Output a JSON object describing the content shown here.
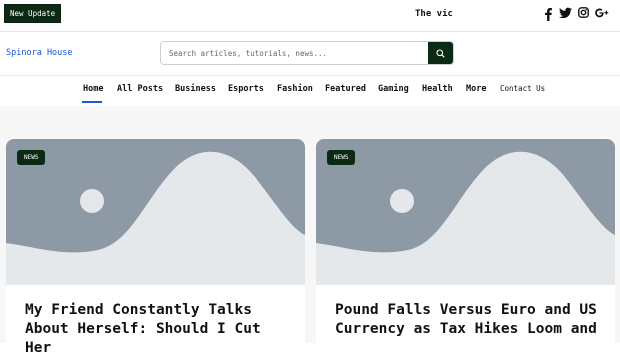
{
  "topbar": {
    "update_label": "New Update",
    "ticker_text": "The vic",
    "social_icons": [
      "facebook-icon",
      "twitter-icon",
      "instagram-icon",
      "google-plus-icon"
    ]
  },
  "header": {
    "site_name": "Spinora House",
    "search_placeholder": "Search articles, tutorials, news...",
    "search_icon": "search-icon"
  },
  "nav": {
    "items": [
      "Home",
      "All Posts",
      "Business",
      "Esports",
      "Fashion",
      "Featured",
      "Gaming",
      "Health",
      "More",
      "Contact Us"
    ],
    "active": "Home"
  },
  "cards": [
    {
      "badge": "NEWS",
      "title": "My Friend Constantly Talks About Herself: Should I Cut Her"
    },
    {
      "badge": "NEWS",
      "title": "Pound Falls Versus Euro and US Currency as Tax Hikes Loom and"
    }
  ],
  "colors": {
    "accent": "#1a56d6",
    "dark_green": "#0b2a14",
    "placeholder_image": "#8e99a6"
  }
}
